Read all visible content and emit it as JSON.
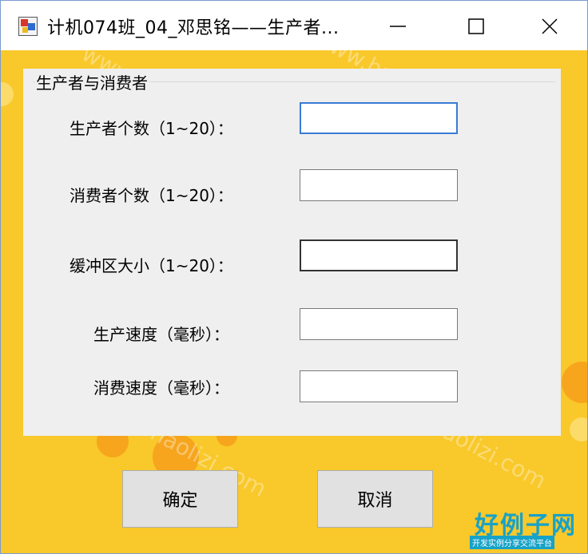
{
  "window": {
    "title": "计机074班_04_邓思铭——生产者..."
  },
  "group": {
    "title": "生产者与消费者"
  },
  "fields": [
    {
      "label": "生产者个数（1~20）：",
      "value": ""
    },
    {
      "label": "消费者个数（1~20）：",
      "value": ""
    },
    {
      "label": "缓冲区大小（1~20）：",
      "value": ""
    },
    {
      "label": "生产速度（毫秒）：",
      "value": ""
    },
    {
      "label": "消费速度（毫秒）：",
      "value": ""
    }
  ],
  "buttons": {
    "ok": "确定",
    "cancel": "取消"
  },
  "watermark": {
    "text": "www.haolizi.com"
  },
  "logo": {
    "main": "好例子网",
    "sub": "开发实例分享交流平台"
  },
  "colors": {
    "background": "#f9c82a",
    "panel": "#efefef",
    "focus_border": "#3a7bd5",
    "logo": "#17a2c8"
  }
}
